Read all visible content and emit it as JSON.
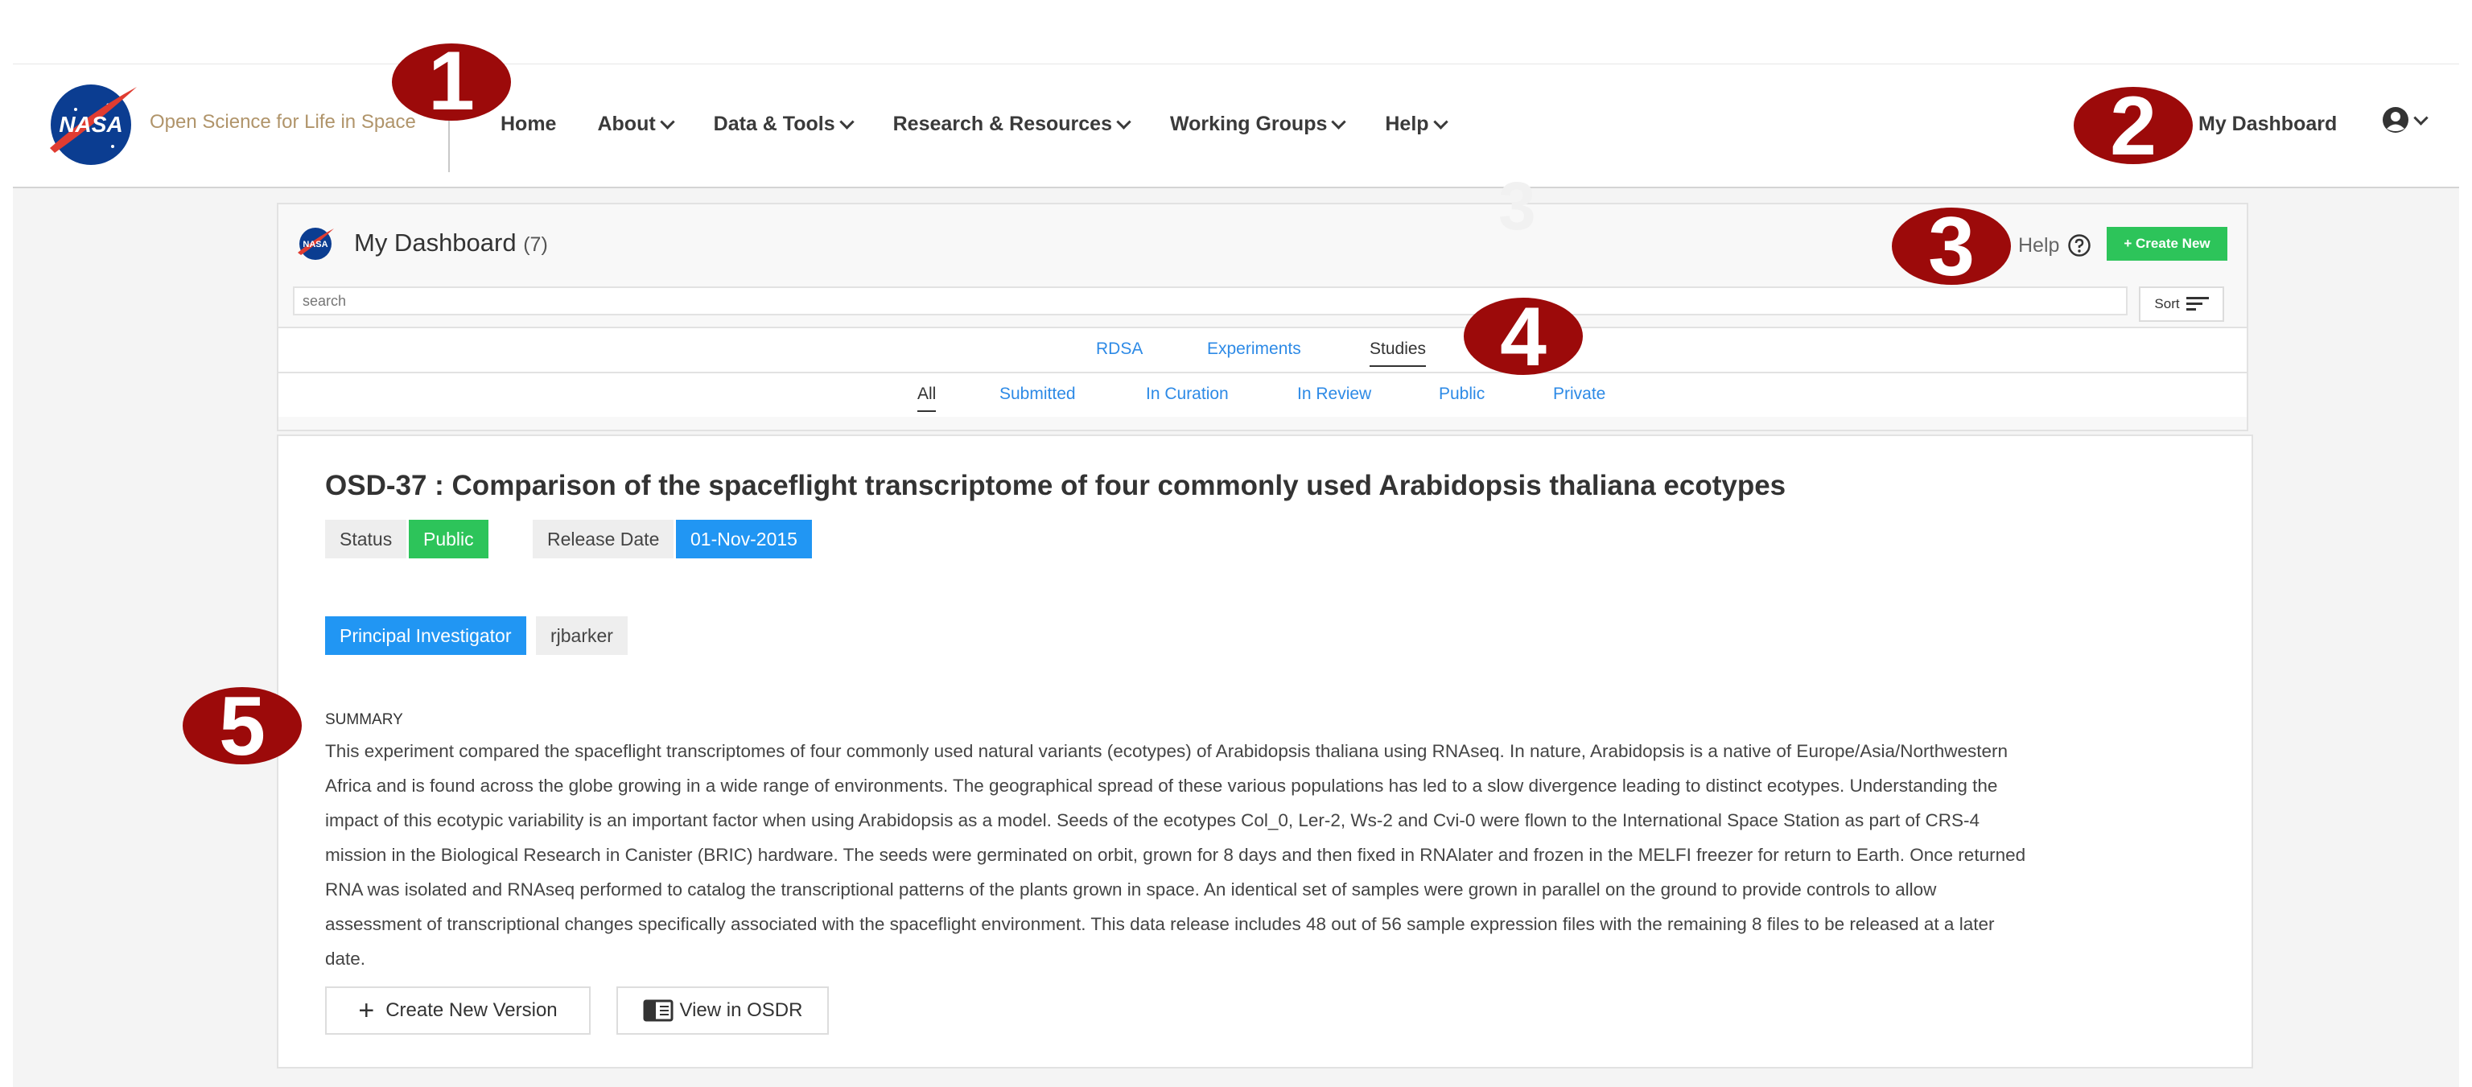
{
  "nav": {
    "brand": "Open Science for Life in Space",
    "logo_text": "NASA",
    "items": [
      {
        "label": "Home",
        "dropdown": false
      },
      {
        "label": "About",
        "dropdown": true
      },
      {
        "label": "Data & Tools",
        "dropdown": true
      },
      {
        "label": "Research & Resources",
        "dropdown": true
      },
      {
        "label": "Working Groups",
        "dropdown": true
      },
      {
        "label": "Help",
        "dropdown": true
      }
    ],
    "my_dashboard": "My Dashboard",
    "user_icon": "user-circle-icon"
  },
  "dashboard": {
    "title": "My Dashboard",
    "count": "(7)",
    "help_label": "Help",
    "create_new": "+ Create New",
    "search_placeholder": "search",
    "sort_label": "Sort",
    "type_tabs": [
      "RDSA",
      "Experiments",
      "Studies"
    ],
    "active_type_tab": "Studies",
    "status_tabs": [
      "All",
      "Submitted",
      "In Curation",
      "In Review",
      "Public",
      "Private"
    ],
    "active_status_tab": "All"
  },
  "study": {
    "title": "OSD-37 : Comparison of the spaceflight transcriptome of four commonly used Arabidopsis thaliana ecotypes",
    "status_label": "Status",
    "status_value": "Public",
    "release_label": "Release Date",
    "release_value": "01-Nov-2015",
    "pi_label": "Principal Investigator",
    "pi_value": "rjbarker",
    "summary_label": "SUMMARY",
    "summary_lines": [
      "This experiment compared the spaceflight transcriptomes of four commonly used natural variants (ecotypes) of Arabidopsis thaliana using RNAseq. In nature, Arabidopsis is a native of Europe/Asia/Northwestern",
      "Africa and is found across the globe growing in a wide range of environments. The geographical spread of these various populations has led to a slow divergence leading to distinct ecotypes. Understanding the",
      "impact of this ecotypic variability is an important factor when using Arabidopsis as a model. Seeds of the ecotypes Col_0, Ler-2, Ws-2 and Cvi-0 were flown to the International Space Station as part of CRS-4",
      "mission in the Biological Research in Canister (BRIC) hardware. The seeds were germinated on orbit, grown for 8 days and then fixed in RNAlater and frozen in the MELFI freezer for return to Earth. Once returned",
      "RNA was isolated and RNAseq performed to catalog the transcriptional patterns of the plants grown in space. An identical set of samples were grown in parallel on the ground to provide controls to allow",
      "assessment of transcriptional changes specifically associated with the spaceflight environment. This data release includes 48 out of 56 sample expression files with the remaining 8 files to be released at a later",
      "date."
    ],
    "create_version": "Create New Version",
    "view_osdr": "View in OSDR"
  },
  "markers": [
    "1",
    "2",
    "3",
    "4",
    "5"
  ],
  "ghost_marker": "3",
  "colors": {
    "marker_red": "#9c0a0a",
    "create_green": "#2dc45a",
    "tag_blue": "#2196f3",
    "link_blue": "#2d8ae6",
    "brand_gold": "#b0946a"
  }
}
